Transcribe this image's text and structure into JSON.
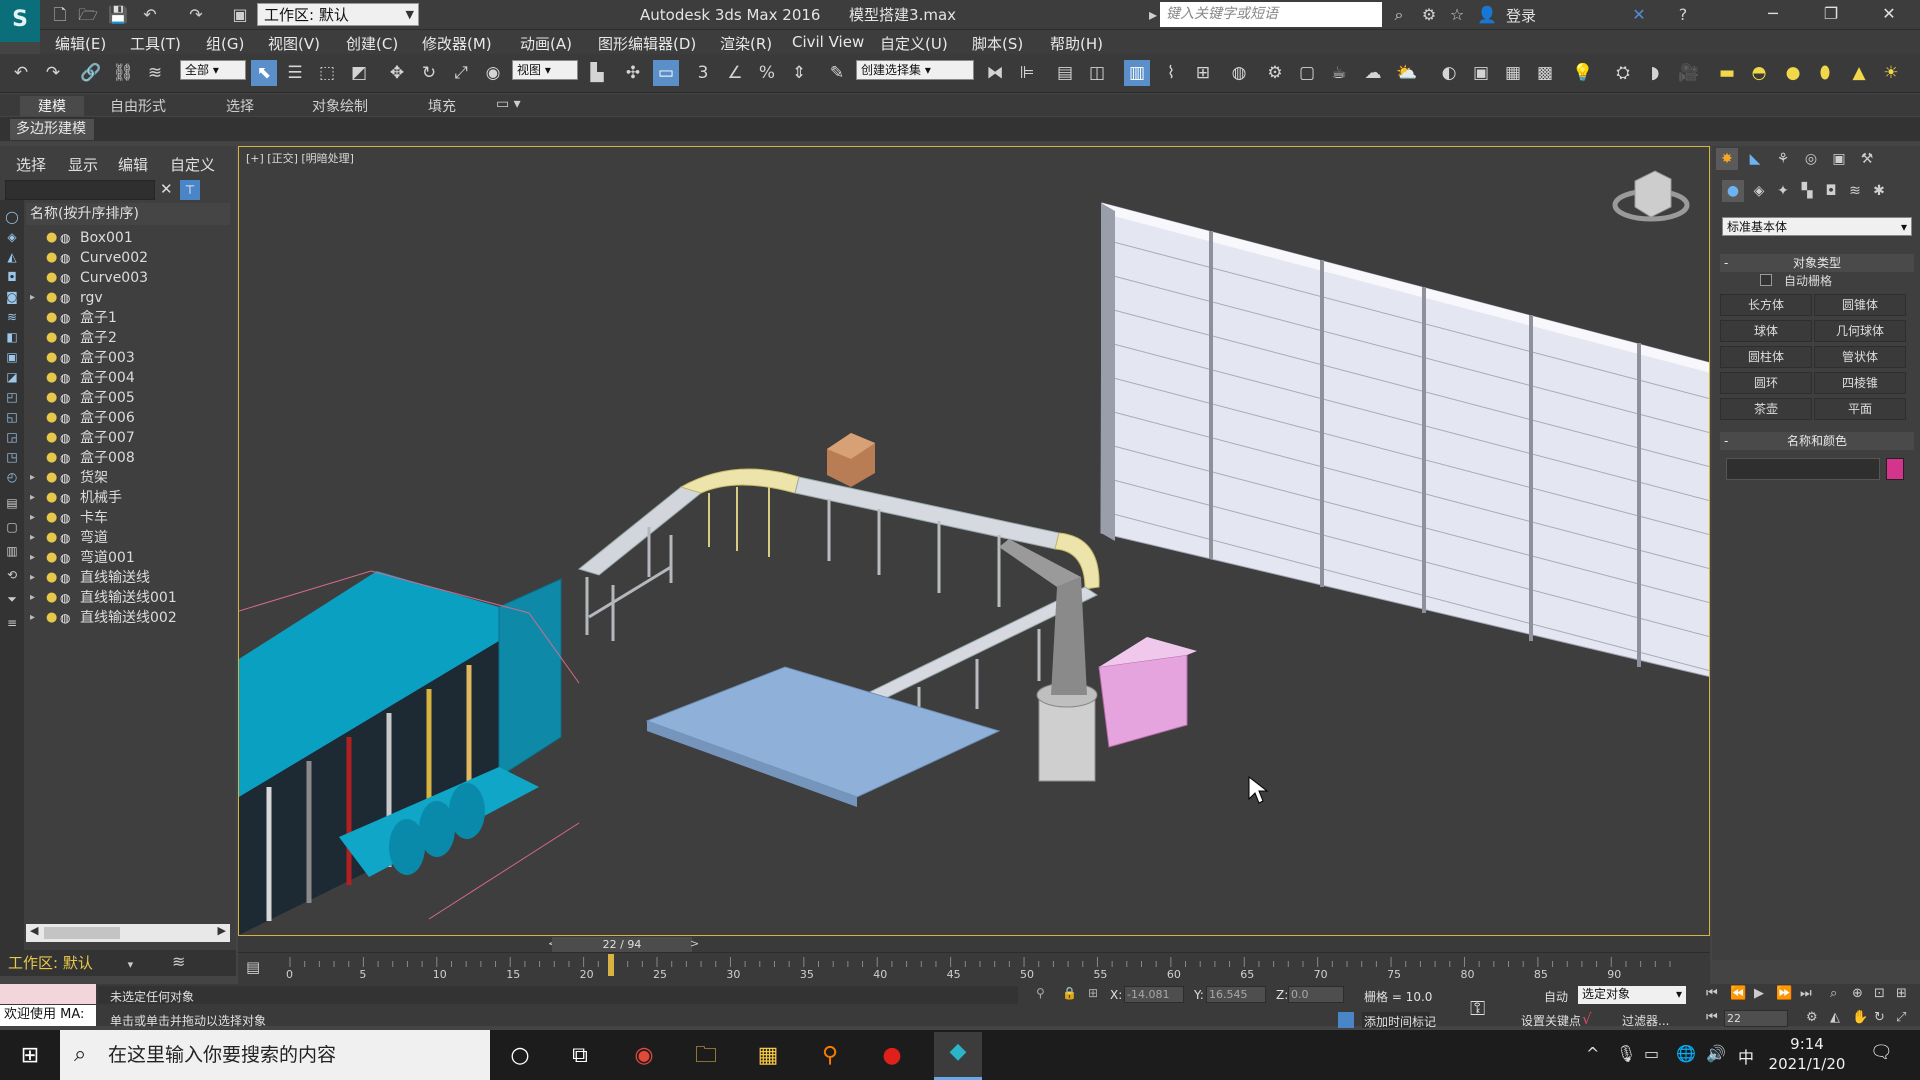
{
  "titlebar": {
    "workspace_combo": "工作区: 默认",
    "app_title": "Autodesk 3ds Max 2016      模型搭建3.max",
    "search_placeholder": "键入关键字或短语",
    "login_label": "登录"
  },
  "menubar": [
    "编辑(E)",
    "工具(T)",
    "组(G)",
    "视图(V)",
    "创建(C)",
    "修改器(M)",
    "动画(A)",
    "图形编辑器(D)",
    "渲染(R)",
    "Civil View",
    "自定义(U)",
    "脚本(S)",
    "帮助(H)"
  ],
  "toolbar": {
    "selection_filter": "全部",
    "ref_coord": "视图",
    "named_selection": "创建选择集"
  },
  "ribbon": {
    "tabs": [
      "建模",
      "自由形式",
      "选择",
      "对象绘制",
      "填充"
    ],
    "active_panel": "多边形建模"
  },
  "scene_explorer": {
    "menus": [
      "选择",
      "显示",
      "编辑",
      "自定义"
    ],
    "column_header": "名称(按升序排序)",
    "rows": [
      {
        "name": "Box001",
        "expand": ""
      },
      {
        "name": "Curve002",
        "expand": ""
      },
      {
        "name": "Curve003",
        "expand": ""
      },
      {
        "name": "rgv",
        "expand": "▸"
      },
      {
        "name": "盒子1",
        "expand": ""
      },
      {
        "name": "盒子2",
        "expand": ""
      },
      {
        "name": "盒子003",
        "expand": ""
      },
      {
        "name": "盒子004",
        "expand": ""
      },
      {
        "name": "盒子005",
        "expand": ""
      },
      {
        "name": "盒子006",
        "expand": ""
      },
      {
        "name": "盒子007",
        "expand": ""
      },
      {
        "name": "盒子008",
        "expand": ""
      },
      {
        "name": "货架",
        "expand": "▸"
      },
      {
        "name": "机械手",
        "expand": "▸"
      },
      {
        "name": "卡车",
        "expand": "▸"
      },
      {
        "name": "弯道",
        "expand": "▸"
      },
      {
        "name": "弯道001",
        "expand": "▸"
      },
      {
        "name": "直线输送线",
        "expand": "▸"
      },
      {
        "name": "直线输送线001",
        "expand": "▸"
      },
      {
        "name": "直线输送线002",
        "expand": "▸"
      }
    ],
    "workspace_footer": "工作区: 默认"
  },
  "viewport": {
    "label": "[+] [正交] [明暗处理]"
  },
  "command_panel": {
    "category": "标准基本体",
    "object_type_title": "对象类型",
    "autogrid": "自动栅格",
    "buttons": [
      "长方体",
      "圆锥体",
      "球体",
      "几何球体",
      "圆柱体",
      "管状体",
      "圆环",
      "四棱锥",
      "茶壶",
      "平面"
    ],
    "name_color_title": "名称和颜色",
    "swatch_color": "#d4348c"
  },
  "timeline": {
    "frame": "22 / 94",
    "ticks": [
      "0",
      "5",
      "10",
      "15",
      "20",
      "25",
      "30",
      "35",
      "40",
      "45",
      "50",
      "55",
      "60",
      "65",
      "70",
      "75",
      "80",
      "85",
      "90"
    ]
  },
  "status": {
    "welcome": "欢迎使用 MA:",
    "message1": "未选定任何对象",
    "message2": "单击或单击并拖动以选择对象",
    "x_label": "X:",
    "x_value": "-14.081",
    "y_label": "Y:",
    "y_value": "16.545",
    "z_label": "Z:",
    "z_value": "0.0",
    "grid": "栅格 = 10.0",
    "auto_key": "自动",
    "selected_combo": "选定对象",
    "set_key": "设置关键点",
    "filters": "过滤器...",
    "add_time_tag": "添加时间标记",
    "frame_field": "22"
  },
  "taskbar": {
    "search_text": "在这里输入你要搜索的内容",
    "time": "9:14",
    "date": "2021/1/20",
    "ime": "中"
  }
}
